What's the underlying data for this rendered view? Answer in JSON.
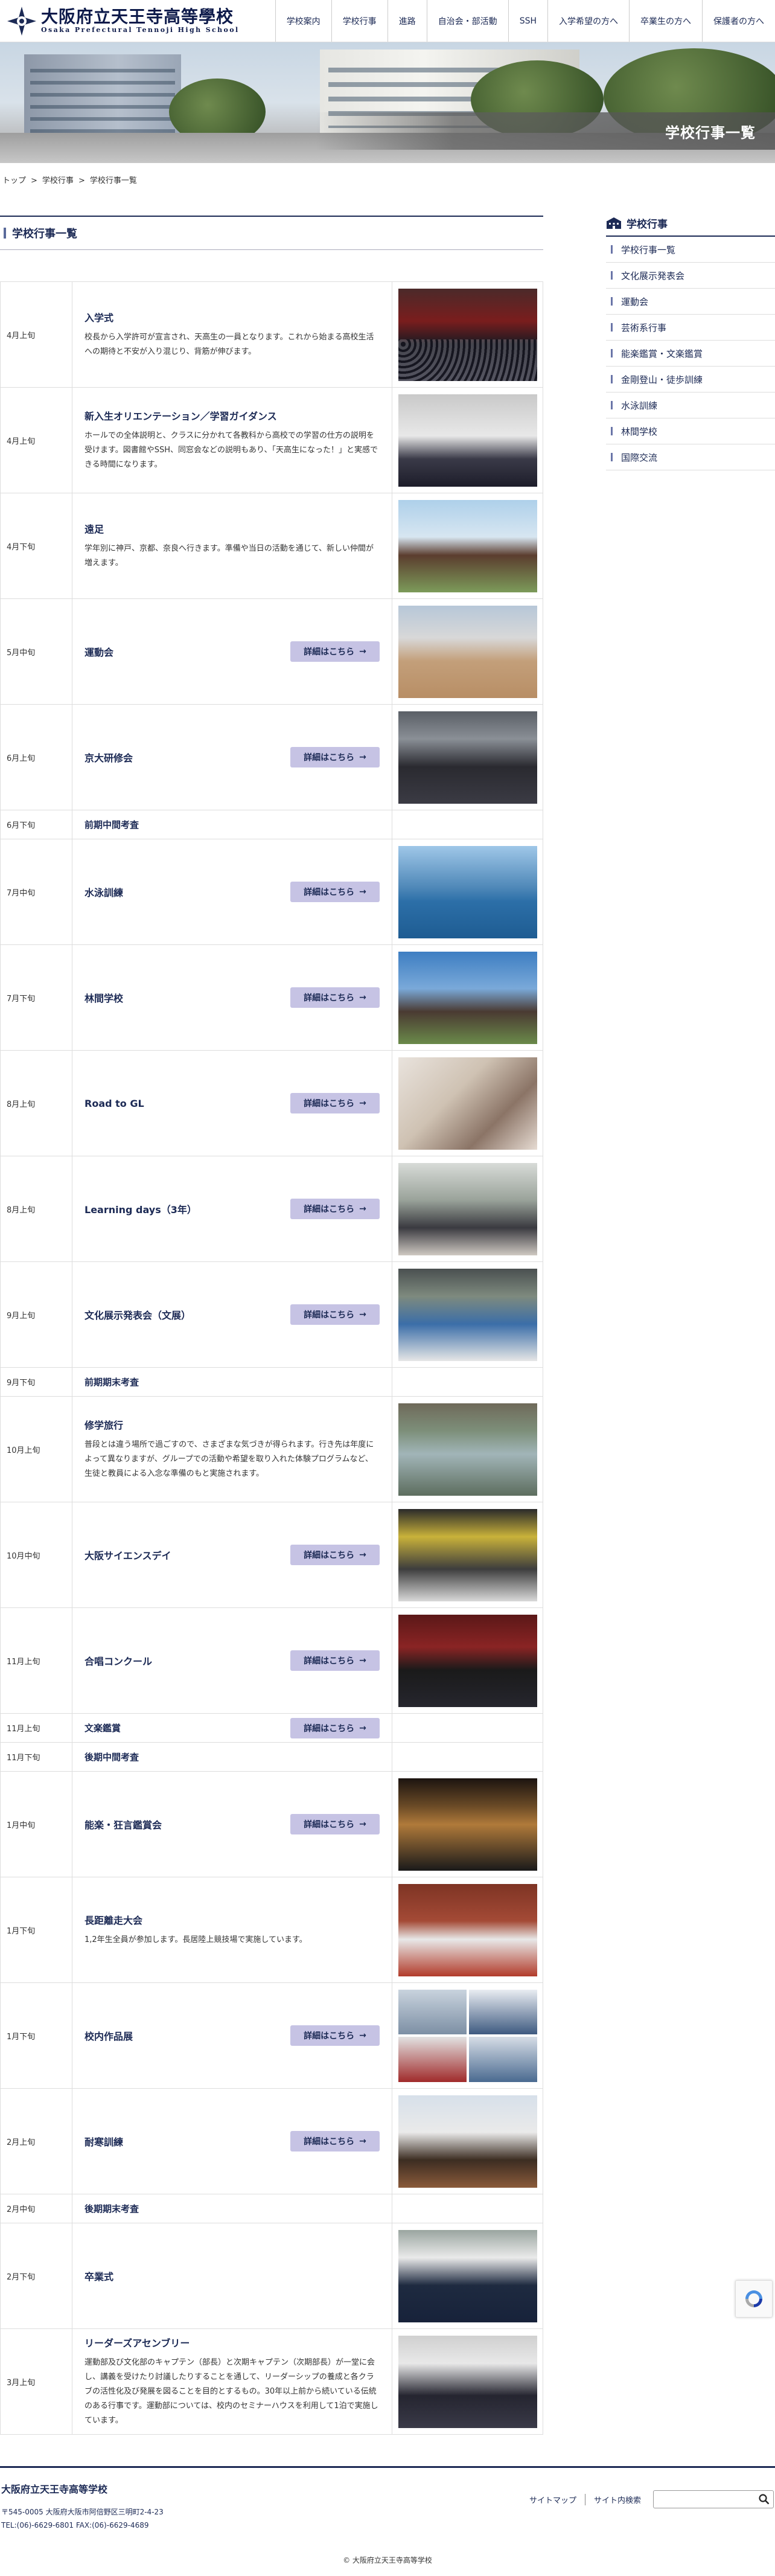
{
  "header": {
    "logo_jp": "大阪府立天王寺高等學校",
    "logo_en": "Osaka Prefectural Tennoji High School",
    "nav": [
      "学校案内",
      "学校行事",
      "進路",
      "自治会・部活動",
      "SSH",
      "入学希望の方へ",
      "卒業生の方へ",
      "保護者の方へ"
    ]
  },
  "hero": {
    "caption": "学校行事一覧"
  },
  "breadcrumb": [
    "トップ",
    "学校行事",
    "学校行事一覧"
  ],
  "page_title": "学校行事一覧",
  "more_label": "詳細はこちら",
  "events": [
    {
      "date": "4月上旬",
      "title": "入学式",
      "desc": "校長から入学許可が宣言され、天高生の一員となります。これから始まる高校生活への期待と不安が入り混じり、背筋が伸びます。",
      "has_button": false,
      "has_image": true
    },
    {
      "date": "4月上旬",
      "title": "新入生オリエンテーション／学習ガイダンス",
      "desc": "ホールでの全体説明と、クラスに分かれて各教科から高校での学習の仕方の説明を受けます。図書館やSSH、同窓会などの説明もあり、「天高生になった！」と実感できる時間になります。",
      "has_button": false,
      "has_image": true
    },
    {
      "date": "4月下旬",
      "title": "遠足",
      "desc": "学年別に神戸、京都、奈良へ行きます。準備や当日の活動を通じて、新しい仲間が増えます。",
      "has_button": false,
      "has_image": true
    },
    {
      "date": "5月中旬",
      "title": "運動会",
      "desc": "",
      "has_button": true,
      "has_image": true
    },
    {
      "date": "6月上旬",
      "title": "京大研修会",
      "desc": "",
      "has_button": true,
      "has_image": true
    },
    {
      "date": "6月下旬",
      "title": "前期中間考査",
      "desc": "",
      "has_button": false,
      "has_image": false
    },
    {
      "date": "7月中旬",
      "title": "水泳訓練",
      "desc": "",
      "has_button": true,
      "has_image": true
    },
    {
      "date": "7月下旬",
      "title": "林間学校",
      "desc": "",
      "has_button": true,
      "has_image": true
    },
    {
      "date": "8月上旬",
      "title": "Road to GL",
      "desc": "",
      "has_button": true,
      "has_image": true
    },
    {
      "date": "8月上旬",
      "title": "Learning days（3年）",
      "desc": "",
      "has_button": true,
      "has_image": true
    },
    {
      "date": "9月上旬",
      "title": "文化展示発表会（文展）",
      "desc": "",
      "has_button": true,
      "has_image": true
    },
    {
      "date": "9月下旬",
      "title": "前期期末考査",
      "desc": "",
      "has_button": false,
      "has_image": false
    },
    {
      "date": "10月上旬",
      "title": "修学旅行",
      "desc": "普段とは違う場所で過ごすので、さまざまな気づきが得られます。行き先は年度によって異なりますが、グループでの活動や希望を取り入れた体験プログラムなど、生徒と教員による入念な準備のもと実施されます。",
      "has_button": false,
      "has_image": true
    },
    {
      "date": "10月中旬",
      "title": "大阪サイエンスデイ",
      "desc": "",
      "has_button": true,
      "has_image": true
    },
    {
      "date": "11月上旬",
      "title": "合唱コンクール",
      "desc": "",
      "has_button": true,
      "has_image": true
    },
    {
      "date": "11月上旬",
      "title": "文楽鑑賞",
      "desc": "",
      "has_button": true,
      "has_image": false
    },
    {
      "date": "11月下旬",
      "title": "後期中間考査",
      "desc": "",
      "has_button": false,
      "has_image": false
    },
    {
      "date": "1月中旬",
      "title": "能楽・狂言鑑賞会",
      "desc": "",
      "has_button": true,
      "has_image": true
    },
    {
      "date": "1月下旬",
      "title": "長距離走大会",
      "desc": "1,2年生全員が参加します。長居陸上競技場で実施しています。",
      "has_button": false,
      "has_image": true
    },
    {
      "date": "1月下旬",
      "title": "校内作品展",
      "desc": "",
      "has_button": true,
      "has_image": true
    },
    {
      "date": "2月上旬",
      "title": "耐寒訓練",
      "desc": "",
      "has_button": true,
      "has_image": true
    },
    {
      "date": "2月中旬",
      "title": "後期期末考査",
      "desc": "",
      "has_button": false,
      "has_image": false
    },
    {
      "date": "2月下旬",
      "title": "卒業式",
      "desc": "",
      "has_button": false,
      "has_image": true
    },
    {
      "date": "3月上旬",
      "title": "リーダーズアセンブリー",
      "desc": "運動部及び文化部のキャプテン（部長）と次期キャプテン（次期部長）が一堂に会し、講義を受けたり討議したりすることを通して、リーダーシップの養成と各クラブの活性化及び発展を図ることを目的とするもの。30年以上前から続いている伝統のある行事です。運動部については、校内のセミナーハウスを利用して1泊で実施しています。",
      "has_button": false,
      "has_image": true
    }
  ],
  "sidebar": {
    "title": "学校行事",
    "items": [
      "学校行事一覧",
      "文化展示発表会",
      "運動会",
      "芸術系行事",
      "能楽鑑賞・文楽鑑賞",
      "金剛登山・徒歩訓練",
      "水泳訓練",
      "林間学校",
      "国際交流"
    ]
  },
  "footer": {
    "school_name": "大阪府立天王寺高等学校",
    "address": "〒545-0005 大阪府大阪市阿倍野区三明町2-4-23",
    "tel": "TEL:(06)-6629-6801 FAX:(06)-6629-4689",
    "sitemap": "サイトマップ",
    "site_search": "サイト内検索",
    "copyright": "© 大阪府立天王寺高等学校"
  }
}
